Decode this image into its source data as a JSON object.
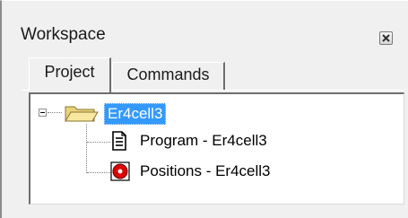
{
  "panel": {
    "title": "Workspace"
  },
  "tabs": [
    {
      "label": "Project",
      "active": true
    },
    {
      "label": "Commands",
      "active": false
    }
  ],
  "tree": {
    "root": {
      "label": "Er4cell3",
      "icon": "folder-open-icon",
      "expanded": true,
      "selected": true
    },
    "children": [
      {
        "label": "Program -  Er4cell3",
        "icon": "document-icon"
      },
      {
        "label": "Positions -  Er4cell3",
        "icon": "red-dot-icon"
      }
    ]
  },
  "colors": {
    "selection": "#3399ff",
    "background": "#f0f0f0",
    "tree_background": "#ffffff",
    "position_icon": "#e00000"
  }
}
